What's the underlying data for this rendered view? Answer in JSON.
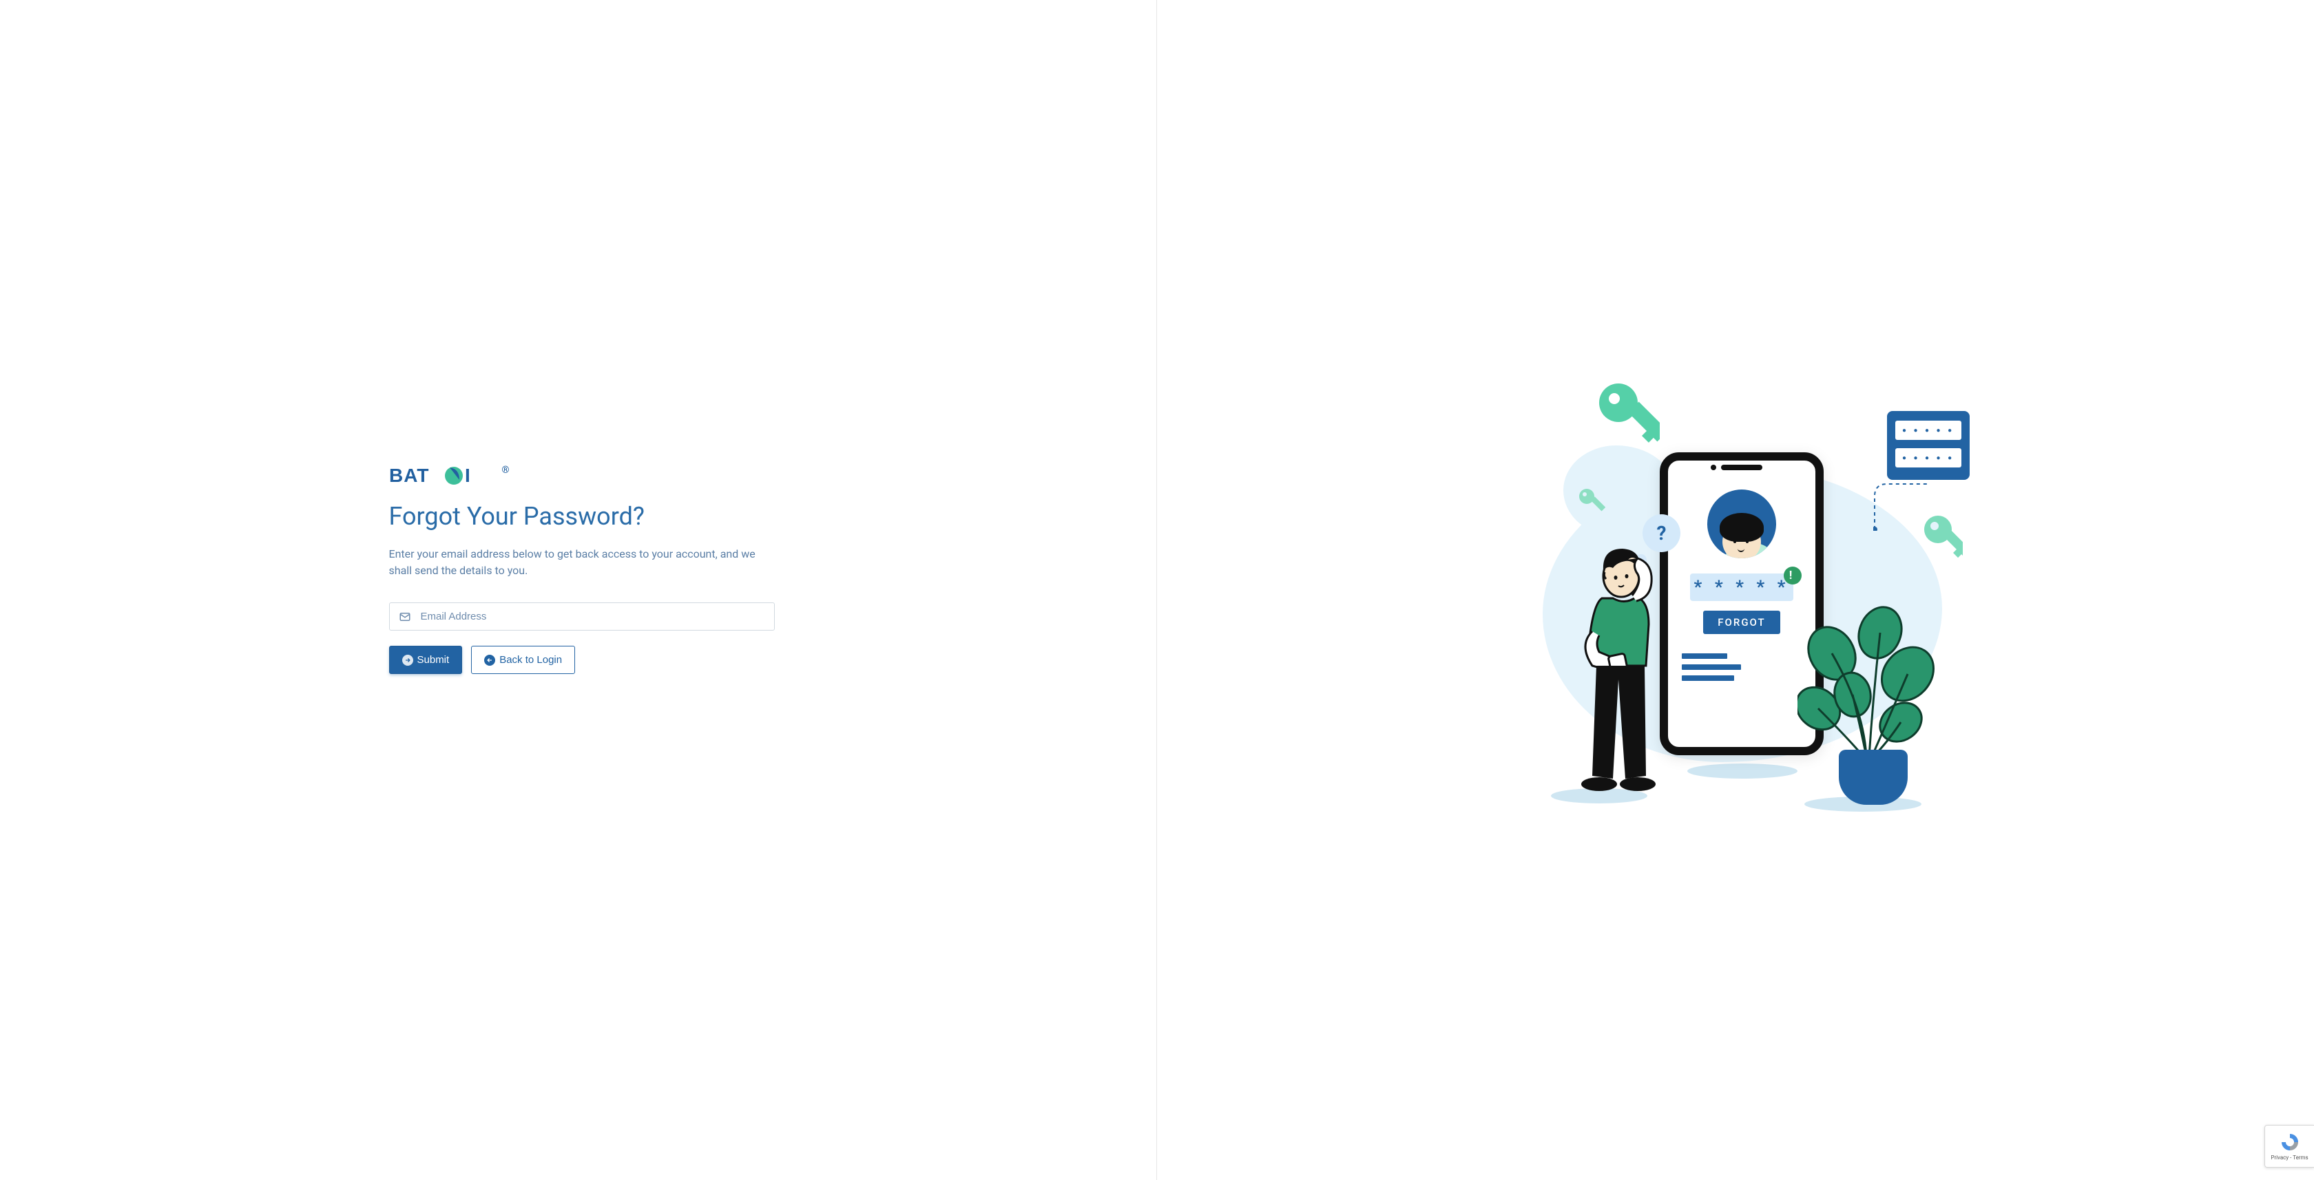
{
  "brand": {
    "name": "BATOI",
    "registered": "®"
  },
  "page": {
    "title": "Forgot Your Password?",
    "description": "Enter your email address below to get back access to your account, and we shall send the details to you."
  },
  "form": {
    "email_placeholder": "Email Address",
    "submit_label": "Submit",
    "back_label": "Back to Login"
  },
  "illustration": {
    "masked_password": "* * * * *",
    "forgot_label": "FORGOT",
    "question": "?",
    "exclaim": "!",
    "dots": "● ● ● ● ●"
  },
  "recaptcha": {
    "line1": "Privacy",
    "line2": "Terms",
    "separator": " - "
  },
  "colors": {
    "primary": "#2263a3",
    "accent": "#3dbf9a",
    "light": "#e4f3fb"
  }
}
